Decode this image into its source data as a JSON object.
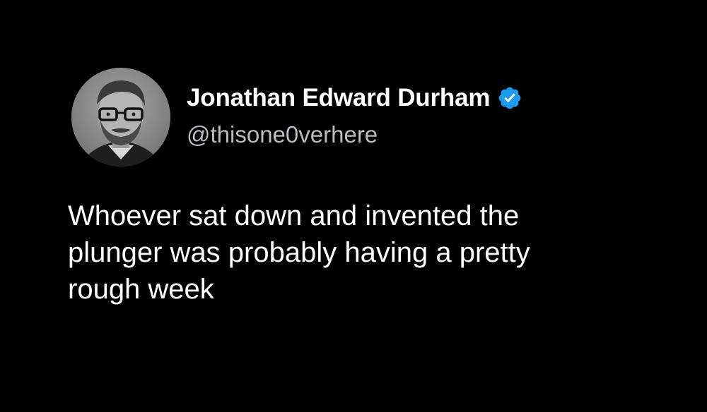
{
  "tweet": {
    "author": {
      "display_name": "Jonathan Edward Durham",
      "handle": "@thisone0verhere",
      "verified_icon": "verified-badge-icon",
      "avatar_icon": "profile-photo"
    },
    "text_lines": [
      "Whoever sat down and invented the",
      "plunger was probably having a pretty",
      "rough week"
    ]
  },
  "colors": {
    "background": "#000000",
    "name": "#ffffff",
    "handle": "#b9bdc1",
    "verified": "#1d9bf0"
  }
}
